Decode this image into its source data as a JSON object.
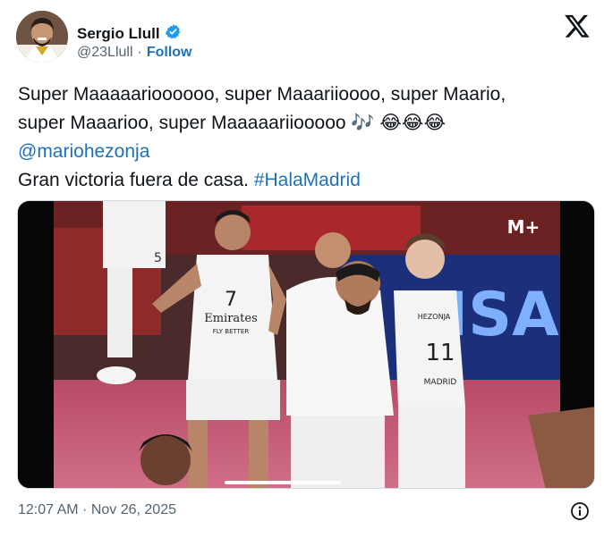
{
  "author": {
    "name": "Sergio Llull",
    "handle": "@23Llull",
    "separator": "·",
    "follow_label": "Follow",
    "verified_color": "#1d9bf0"
  },
  "tweet": {
    "line1": "Super Maaaaarioooooo, super Maaariioooo, super Maario,",
    "line2_text": "super Maaarioo, super Maaaaariiooooo",
    "line2_emoji": "🎶 😂😂😂",
    "mention": "@mariohezonja",
    "line4_text": "Gran victoria fuera de casa.",
    "hashtag": "#HalaMadrid"
  },
  "media": {
    "type": "video",
    "broadcaster_logo": "M+",
    "sponsor_text": "VISA",
    "player_front_number": "7",
    "player_front_sponsor": "Emirates",
    "player_front_sponsor_sub": "FLY BETTER",
    "player_back_number": "11",
    "player_back_name": "HEZONJA",
    "player_back_club": "MADRID",
    "left_player_number": "5"
  },
  "footer": {
    "timestamp": "12:07 AM · Nov 26, 2025",
    "info_icon": "info-icon"
  },
  "colors": {
    "link": "#1d71b8",
    "text": "#0f1419",
    "muted": "#536471"
  }
}
